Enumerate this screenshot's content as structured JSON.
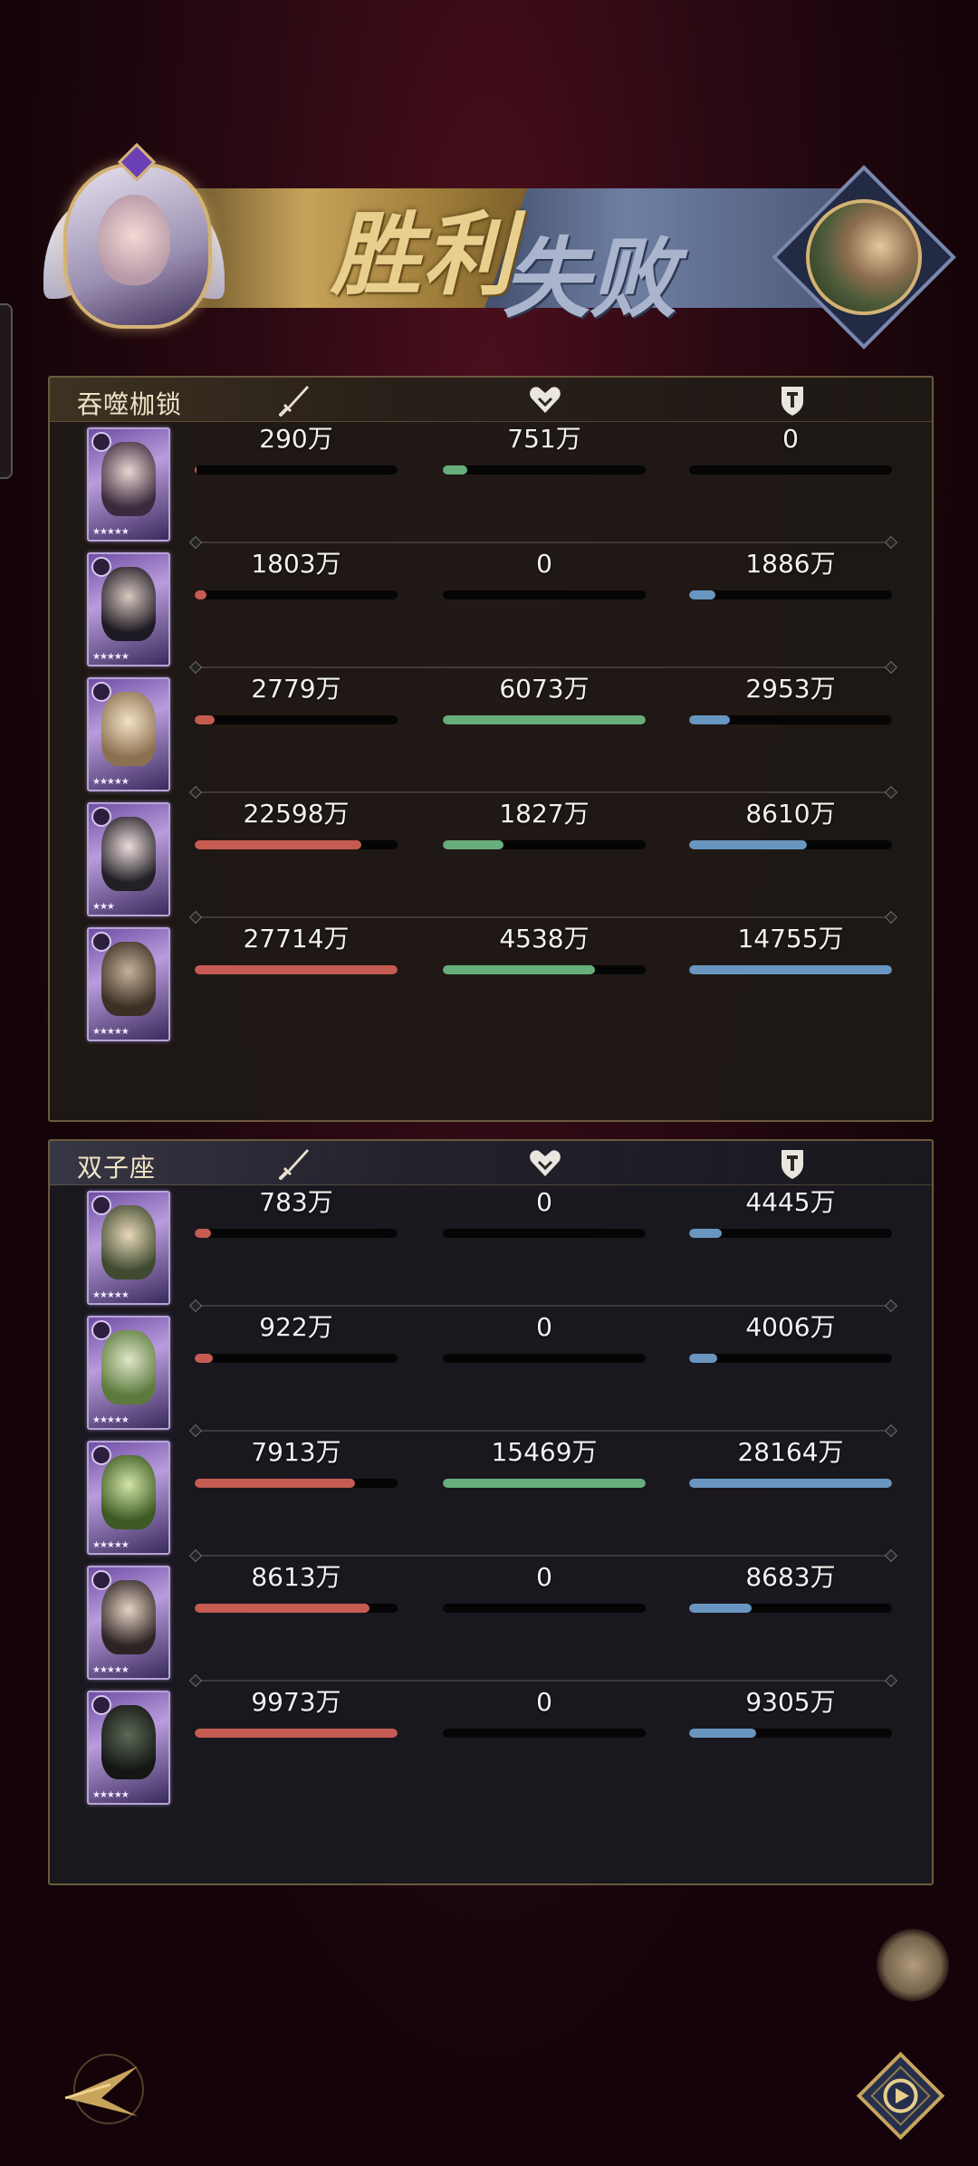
{
  "banner": {
    "victory_label": "胜利",
    "defeat_label": "失败"
  },
  "teams": [
    {
      "name": "吞噬枷锁",
      "rows": [
        {
          "damage": "290万",
          "heal": "751万",
          "tank": "0",
          "damage_fill": 0.01,
          "heal_fill": 0.12,
          "tank_fill": 0.0
        },
        {
          "damage": "1803万",
          "heal": "0",
          "tank": "1886万",
          "damage_fill": 0.06,
          "heal_fill": 0.0,
          "tank_fill": 0.13
        },
        {
          "damage": "2779万",
          "heal": "6073万",
          "tank": "2953万",
          "damage_fill": 0.1,
          "heal_fill": 1.0,
          "tank_fill": 0.2
        },
        {
          "damage": "22598万",
          "heal": "1827万",
          "tank": "8610万",
          "damage_fill": 0.82,
          "heal_fill": 0.3,
          "tank_fill": 0.58
        },
        {
          "damage": "27714万",
          "heal": "4538万",
          "tank": "14755万",
          "damage_fill": 1.0,
          "heal_fill": 0.75,
          "tank_fill": 1.0
        }
      ]
    },
    {
      "name": "双子座",
      "rows": [
        {
          "damage": "783万",
          "heal": "0",
          "tank": "4445万",
          "damage_fill": 0.08,
          "heal_fill": 0.0,
          "tank_fill": 0.16
        },
        {
          "damage": "922万",
          "heal": "0",
          "tank": "4006万",
          "damage_fill": 0.09,
          "heal_fill": 0.0,
          "tank_fill": 0.14
        },
        {
          "damage": "7913万",
          "heal": "15469万",
          "tank": "28164万",
          "damage_fill": 0.79,
          "heal_fill": 1.0,
          "tank_fill": 1.0
        },
        {
          "damage": "8613万",
          "heal": "0",
          "tank": "8683万",
          "damage_fill": 0.86,
          "heal_fill": 0.0,
          "tank_fill": 0.31
        },
        {
          "damage": "9973万",
          "heal": "0",
          "tank": "9305万",
          "damage_fill": 1.0,
          "heal_fill": 0.0,
          "tank_fill": 0.33
        }
      ]
    }
  ],
  "colors": {
    "damage": "#c65b52",
    "heal": "#68ae7d",
    "tank": "#6996c0"
  },
  "icons": {
    "damage_header": "sword-icon",
    "heal_header": "heart-icon",
    "tank_header": "shield-icon",
    "back": "back-arrow-icon",
    "replay": "replay-icon"
  }
}
